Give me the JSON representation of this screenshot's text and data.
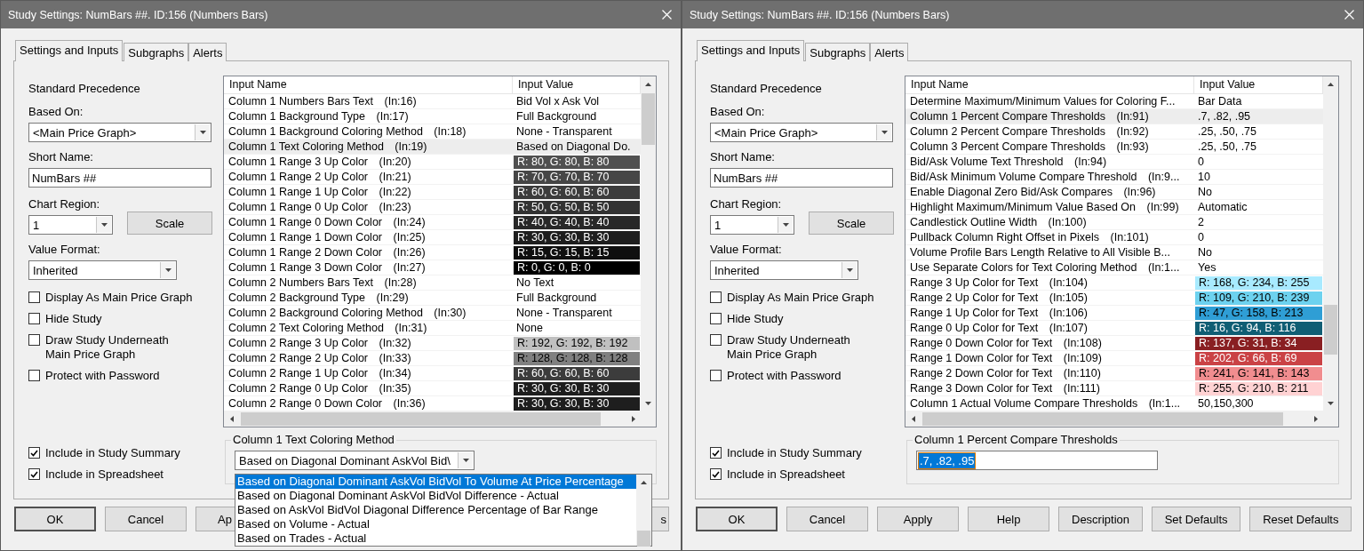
{
  "dialogs": [
    {
      "title": "Study Settings: NumBars ##. ID:156 (Numbers Bars)",
      "tabs": [
        {
          "label": "Settings and Inputs",
          "selected": true
        },
        {
          "label": "Subgraphs",
          "selected": false
        },
        {
          "label": "Alerts",
          "selected": false
        }
      ],
      "precedence": "Standard Precedence",
      "based_on": {
        "label": "Based On:",
        "value": "<Main Price Graph>"
      },
      "short_name": {
        "label": "Short Name:",
        "value": "NumBars ##"
      },
      "chart_region": {
        "label": "Chart Region:",
        "value": "1"
      },
      "scale_button": "Scale",
      "value_format": {
        "label": "Value Format:",
        "value": "Inherited"
      },
      "options": [
        {
          "label": "Display As Main Price Graph",
          "checked": false
        },
        {
          "label": "Hide Study",
          "checked": false
        },
        {
          "label": "Draw Study Underneath\nMain Price Graph",
          "checked": false
        },
        {
          "label": "Protect with Password",
          "checked": false
        }
      ],
      "summary_options": [
        {
          "label": "Include in Study Summary",
          "checked": true
        },
        {
          "label": "Include in Spreadsheet",
          "checked": true
        }
      ],
      "table": {
        "columns": [
          "Input Name",
          "Input Value"
        ],
        "rows": [
          {
            "name": "Column 1 Numbers Bars Text",
            "code": "(In:16)",
            "kind": "text",
            "value": "Bid Vol x Ask Vol",
            "selected": false
          },
          {
            "name": "Column 1 Background Type",
            "code": "(In:17)",
            "kind": "text",
            "value": "Full Background",
            "selected": false
          },
          {
            "name": "Column 1 Background Coloring Method",
            "code": "(In:18)",
            "kind": "text",
            "value": "None - Transparent",
            "selected": false
          },
          {
            "name": "Column 1 Text Coloring Method",
            "code": "(In:19)",
            "kind": "text",
            "value": "Based on Diagonal Do.",
            "selected": true
          },
          {
            "name": "Column 1 Range 3 Up Color",
            "code": "(In:20)",
            "kind": "color",
            "color": "#505050",
            "value": "R: 80, G: 80, B: 80",
            "selected": false
          },
          {
            "name": "Column 1 Range 2 Up Color",
            "code": "(In:21)",
            "kind": "color",
            "color": "#464646",
            "value": "R: 70, G: 70, B: 70",
            "selected": false
          },
          {
            "name": "Column 1 Range 1 Up Color",
            "code": "(In:22)",
            "kind": "color",
            "color": "#3c3c3c",
            "value": "R: 60, G: 60, B: 60",
            "selected": false
          },
          {
            "name": "Column 1 Range 0 Up Color",
            "code": "(In:23)",
            "kind": "color",
            "color": "#323232",
            "value": "R: 50, G: 50, B: 50",
            "selected": false
          },
          {
            "name": "Column 1 Range 0 Down Color",
            "code": "(In:24)",
            "kind": "color",
            "color": "#282828",
            "value": "R: 40, G: 40, B: 40",
            "selected": false
          },
          {
            "name": "Column 1 Range 1 Down Color",
            "code": "(In:25)",
            "kind": "color",
            "color": "#1e1e1e",
            "value": "R: 30, G: 30, B: 30",
            "selected": false
          },
          {
            "name": "Column 1 Range 2 Down Color",
            "code": "(In:26)",
            "kind": "color",
            "color": "#0f0f0f",
            "value": "R: 15, G: 15, B: 15",
            "selected": false
          },
          {
            "name": "Column 1 Range 3 Down Color",
            "code": "(In:27)",
            "kind": "color",
            "color": "#000000",
            "value": "R: 0, G: 0, B: 0",
            "selected": false
          },
          {
            "name": "Column 2 Numbers Bars Text",
            "code": "(In:28)",
            "kind": "text",
            "value": "No Text",
            "selected": false
          },
          {
            "name": "Column 2 Background Type",
            "code": "(In:29)",
            "kind": "text",
            "value": "Full Background",
            "selected": false
          },
          {
            "name": "Column 2 Background Coloring Method",
            "code": "(In:30)",
            "kind": "text",
            "value": "None - Transparent",
            "selected": false
          },
          {
            "name": "Column 2 Text Coloring Method",
            "code": "(In:31)",
            "kind": "text",
            "value": "None",
            "selected": false
          },
          {
            "name": "Column 2 Range 3 Up Color",
            "code": "(In:32)",
            "kind": "color",
            "color": "#c0c0c0",
            "value": "R: 192, G: 192, B: 192",
            "selected": false
          },
          {
            "name": "Column 2 Range 2 Up Color",
            "code": "(In:33)",
            "kind": "color",
            "color": "#808080",
            "value": "R: 128, G: 128, B: 128",
            "selected": false
          },
          {
            "name": "Column 2 Range 1 Up Color",
            "code": "(In:34)",
            "kind": "color",
            "color": "#3c3c3c",
            "value": "R: 60, G: 60, B: 60",
            "selected": false
          },
          {
            "name": "Column 2 Range 0 Up Color",
            "code": "(In:35)",
            "kind": "color",
            "color": "#1e1e1e",
            "value": "R: 30, G: 30, B: 30",
            "selected": false
          },
          {
            "name": "Column 2 Range 0 Down Color",
            "code": "(In:36)",
            "kind": "color",
            "color": "#1e1e1e",
            "value": "R: 30, G: 30, B: 30",
            "selected": false
          }
        ]
      },
      "editor": {
        "kind": "dropdown",
        "title": "Column 1 Text Coloring Method",
        "value": "Based on Diagonal Dominant AskVol Bid\\",
        "list": [
          {
            "label": "Based on Diagonal Dominant AskVol BidVol To Volume At Price Percentage",
            "selected": true
          },
          {
            "label": "Based on Diagonal Dominant AskVol BidVol Difference - Actual",
            "selected": false
          },
          {
            "label": "Based on AskVol BidVol Diagonal Difference Percentage of Bar Range",
            "selected": false
          },
          {
            "label": "Based on Volume - Actual",
            "selected": false
          },
          {
            "label": "Based on Trades - Actual",
            "selected": false
          }
        ]
      },
      "buttons": [
        {
          "label": "OK",
          "default": true,
          "kind": "full"
        },
        {
          "label": "Cancel",
          "default": false,
          "kind": "full"
        },
        {
          "label": "Ap",
          "default": false,
          "kind": "cut_left"
        },
        {
          "label": "s",
          "default": false,
          "kind": "cut_right"
        }
      ]
    },
    {
      "title": "Study Settings: NumBars ##. ID:156 (Numbers Bars)",
      "tabs": [
        {
          "label": "Settings and Inputs",
          "selected": true
        },
        {
          "label": "Subgraphs",
          "selected": false
        },
        {
          "label": "Alerts",
          "selected": false
        }
      ],
      "precedence": "Standard Precedence",
      "based_on": {
        "label": "Based On:",
        "value": "<Main Price Graph>"
      },
      "short_name": {
        "label": "Short Name:",
        "value": "NumBars ##"
      },
      "chart_region": {
        "label": "Chart Region:",
        "value": "1"
      },
      "scale_button": "Scale",
      "value_format": {
        "label": "Value Format:",
        "value": "Inherited"
      },
      "options": [
        {
          "label": "Display As Main Price Graph",
          "checked": false
        },
        {
          "label": "Hide Study",
          "checked": false
        },
        {
          "label": "Draw Study Underneath\nMain Price Graph",
          "checked": false
        },
        {
          "label": "Protect with Password",
          "checked": false
        }
      ],
      "summary_options": [
        {
          "label": "Include in Study Summary",
          "checked": true
        },
        {
          "label": "Include in Spreadsheet",
          "checked": true
        }
      ],
      "table": {
        "columns": [
          "Input Name",
          "Input Value"
        ],
        "rows": [
          {
            "name": "Determine Maximum/Minimum Values for Coloring F...",
            "kind": "text",
            "value": "Bar Data",
            "selected": false
          },
          {
            "name": "Column 1 Percent Compare Thresholds",
            "code": "(In:91)",
            "kind": "text",
            "value": ".7, .82, .95",
            "selected": true
          },
          {
            "name": "Column 2 Percent Compare Thresholds",
            "code": "(In:92)",
            "kind": "text",
            "value": ".25, .50, .75",
            "selected": false
          },
          {
            "name": "Column 3 Percent Compare Thresholds",
            "code": "(In:93)",
            "kind": "text",
            "value": ".25, .50, .75",
            "selected": false
          },
          {
            "name": "Bid/Ask Volume Text Threshold",
            "code": "(In:94)",
            "kind": "text",
            "value": "0",
            "selected": false
          },
          {
            "name": "Bid/Ask Minimum Volume Compare Threshold",
            "code": "(In:9...",
            "kind": "text",
            "value": "10",
            "selected": false
          },
          {
            "name": "Enable Diagonal Zero Bid/Ask Compares",
            "code": "(In:96)",
            "kind": "text",
            "value": "No",
            "selected": false
          },
          {
            "name": "Highlight Maximum/Minimum Value Based On",
            "code": "(In:99)",
            "kind": "text",
            "value": "Automatic",
            "selected": false
          },
          {
            "name": "Candlestick Outline Width",
            "code": "(In:100)",
            "kind": "text",
            "value": "2",
            "selected": false
          },
          {
            "name": "Pullback Column Right Offset in Pixels",
            "code": "(In:101)",
            "kind": "text",
            "value": "0",
            "selected": false
          },
          {
            "name": "Volume Profile Bars Length Relative to All Visible B...",
            "kind": "text",
            "value": "No",
            "selected": false
          },
          {
            "name": "Use Separate Colors for Text Coloring Method",
            "code": "(In:1...",
            "kind": "text",
            "value": "Yes",
            "selected": false
          },
          {
            "name": "Range 3 Up Color for Text",
            "code": "(In:104)",
            "kind": "color",
            "color": "#a8eaff",
            "value": "R: 168, G: 234, B: 255",
            "selected": false
          },
          {
            "name": "Range 2 Up Color for Text",
            "code": "(In:105)",
            "kind": "color",
            "color": "#6dd2ef",
            "value": "R: 109, G: 210, B: 239",
            "selected": false
          },
          {
            "name": "Range 1 Up Color for Text",
            "code": "(In:106)",
            "kind": "color",
            "color": "#2f9ed5",
            "value": "R: 47, G: 158, B: 213",
            "selected": false
          },
          {
            "name": "Range 0 Up Color for Text",
            "code": "(In:107)",
            "kind": "color",
            "color": "#105e74",
            "value": "R: 16, G: 94, B: 116",
            "selected": false
          },
          {
            "name": "Range 0 Down Color for Text",
            "code": "(In:108)",
            "kind": "color",
            "color": "#891f22",
            "value": "R: 137, G: 31, B: 34",
            "selected": false
          },
          {
            "name": "Range 1 Down Color for Text",
            "code": "(In:109)",
            "kind": "color",
            "color": "#ca4245",
            "value": "R: 202, G: 66, B: 69",
            "selected": false
          },
          {
            "name": "Range 2 Down Color for Text",
            "code": "(In:110)",
            "kind": "color",
            "color": "#f18d8f",
            "value": "R: 241, G: 141, B: 143",
            "selected": false
          },
          {
            "name": "Range 3 Down Color for Text",
            "code": "(In:111)",
            "kind": "color",
            "color": "#ffd2d3",
            "value": "R: 255, G: 210, B: 211",
            "selected": false
          },
          {
            "name": "Column 1 Actual Volume Compare Thresholds",
            "code": "(In:1...",
            "kind": "text",
            "value": "50,150,300",
            "selected": false
          }
        ]
      },
      "editor": {
        "kind": "input",
        "title": "Column 1 Percent Compare Thresholds",
        "value": ".7, .82, .95",
        "highlighted": true
      },
      "buttons": [
        {
          "label": "OK",
          "default": true,
          "kind": "full"
        },
        {
          "label": "Cancel",
          "default": false,
          "kind": "full"
        },
        {
          "label": "Apply",
          "default": false,
          "kind": "full"
        },
        {
          "label": "Help",
          "default": false,
          "kind": "full"
        },
        {
          "label": "Description",
          "default": false,
          "kind": "full"
        },
        {
          "label": "Set Defaults",
          "default": false,
          "kind": "full"
        },
        {
          "label": "Reset Defaults",
          "default": false,
          "kind": "full"
        }
      ]
    }
  ]
}
